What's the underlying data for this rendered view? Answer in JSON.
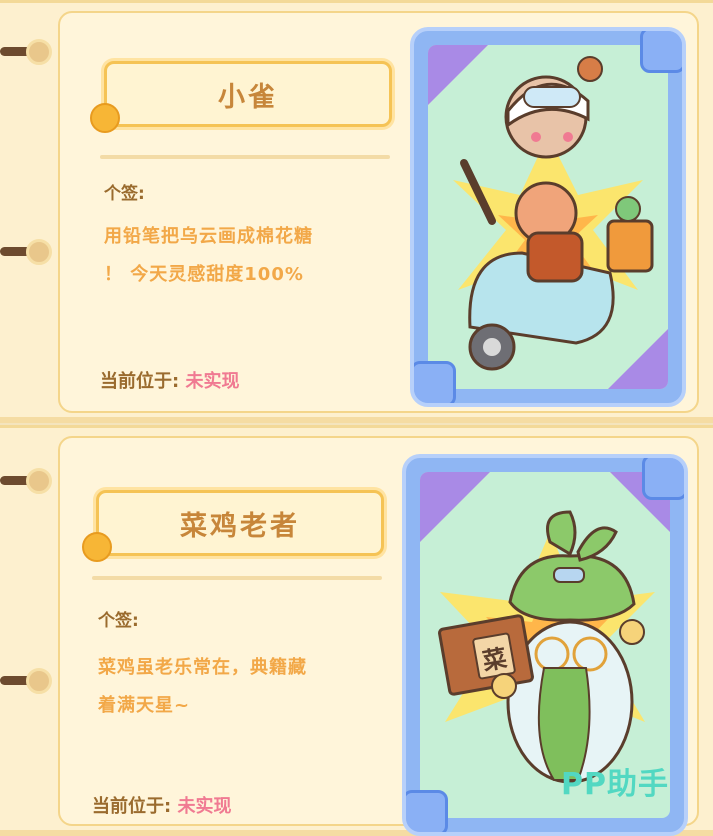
{
  "cards": [
    {
      "name": "小雀",
      "sign_label": "个签:",
      "sign_lines": [
        "用铅笔把乌云画成棉花糖",
        "！ 今天灵感甜度100%"
      ],
      "location_label": "当前位于:",
      "location_value": "未实现",
      "portrait_icon": "girl-on-scooter-illustration"
    },
    {
      "name": "菜鸡老者",
      "sign_label": "个签:",
      "sign_lines": [
        "菜鸡虽老乐常在，典籍藏",
        "着满天星~"
      ],
      "location_label": "当前位于:",
      "location_value": "未实现",
      "portrait_icon": "radish-elder-reading-book-illustration",
      "book_char": "菜"
    }
  ],
  "watermark": "PP助手",
  "colors": {
    "name_text": "#c7863a",
    "sign_text": "#f2a848",
    "label_text": "#9a6b2e",
    "location_value": "#f07a92",
    "portrait_frame": "#8fb6f3"
  }
}
